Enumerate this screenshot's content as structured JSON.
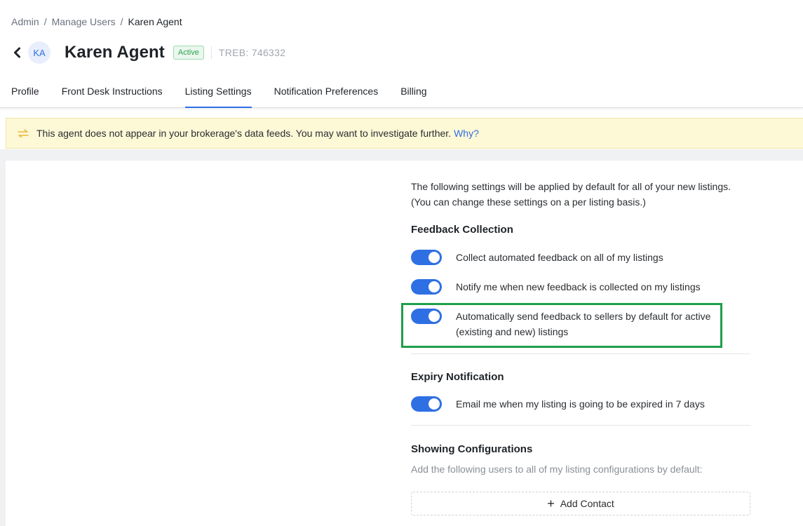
{
  "breadcrumb": {
    "items": [
      "Admin",
      "Manage Users",
      "Karen Agent"
    ],
    "separator": "/"
  },
  "agent": {
    "initials": "KA",
    "name": "Karen Agent",
    "status": "Active",
    "treb": "TREB: 746332"
  },
  "tabs": [
    {
      "label": "Profile",
      "active": false
    },
    {
      "label": "Front Desk Instructions",
      "active": false
    },
    {
      "label": "Listing Settings",
      "active": true
    },
    {
      "label": "Notification Preferences",
      "active": false
    },
    {
      "label": "Billing",
      "active": false
    }
  ],
  "alert": {
    "message": "This agent does not appear in your brokerage's data feeds. You may want to investigate further.",
    "link": "Why?"
  },
  "settings": {
    "intro": "The following settings will be applied by default for all of your new listings. (You can change these settings on a per listing basis.)",
    "feedback": {
      "title": "Feedback Collection",
      "items": [
        {
          "label": "Collect automated feedback on all of my listings",
          "enabled": true
        },
        {
          "label": "Notify me when new feedback is collected on my listings",
          "enabled": true
        },
        {
          "label": "Automatically send feedback to sellers by default for active (existing and new) listings",
          "enabled": true
        }
      ]
    },
    "expiry": {
      "title": "Expiry Notification",
      "items": [
        {
          "label": "Email me when my listing is going to be expired in 7 days",
          "enabled": true
        }
      ]
    },
    "showing": {
      "title": "Showing Configurations",
      "subtitle": "Add the following users to all of my listing configurations by default:",
      "add_button": "Add Contact"
    }
  },
  "colors": {
    "accent": "#2f6fe4",
    "highlight": "#1e9e4a",
    "alert_bg": "#fdf8d6",
    "status_green": "#2ca44e"
  }
}
